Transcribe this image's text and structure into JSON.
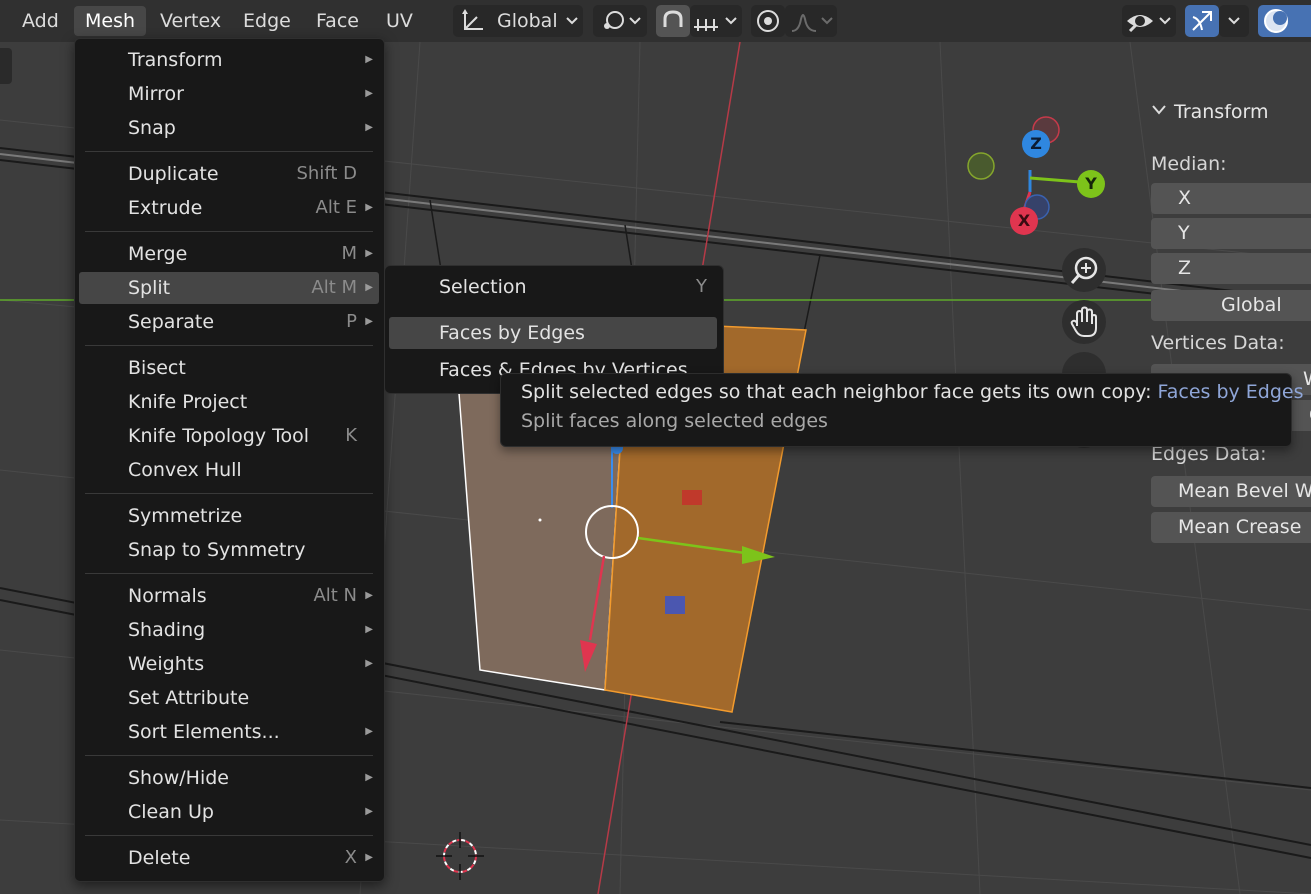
{
  "header": {
    "menus": [
      "Add",
      "Mesh",
      "Vertex",
      "Edge",
      "Face",
      "UV"
    ],
    "active_menu": "Mesh",
    "orientation": "Global"
  },
  "mesh_menu": {
    "items": [
      {
        "label": "Transform",
        "shortcut": "",
        "submenu": true
      },
      {
        "label": "Mirror",
        "shortcut": "",
        "submenu": true
      },
      {
        "label": "Snap",
        "shortcut": "",
        "submenu": true
      },
      {
        "label": "Duplicate",
        "shortcut": "Shift D",
        "submenu": false
      },
      {
        "label": "Extrude",
        "shortcut": "Alt E",
        "submenu": true
      },
      {
        "label": "Merge",
        "shortcut": "M",
        "submenu": true
      },
      {
        "label": "Split",
        "shortcut": "Alt M",
        "submenu": true
      },
      {
        "label": "Separate",
        "shortcut": "P",
        "submenu": true
      },
      {
        "label": "Bisect",
        "shortcut": "",
        "submenu": false
      },
      {
        "label": "Knife Project",
        "shortcut": "",
        "submenu": false
      },
      {
        "label": "Knife Topology Tool",
        "shortcut": "K",
        "submenu": false
      },
      {
        "label": "Convex Hull",
        "shortcut": "",
        "submenu": false
      },
      {
        "label": "Symmetrize",
        "shortcut": "",
        "submenu": false
      },
      {
        "label": "Snap to Symmetry",
        "shortcut": "",
        "submenu": false
      },
      {
        "label": "Normals",
        "shortcut": "Alt N",
        "submenu": true
      },
      {
        "label": "Shading",
        "shortcut": "",
        "submenu": true
      },
      {
        "label": "Weights",
        "shortcut": "",
        "submenu": true
      },
      {
        "label": "Set Attribute",
        "shortcut": "",
        "submenu": false
      },
      {
        "label": "Sort Elements...",
        "shortcut": "",
        "submenu": true
      },
      {
        "label": "Show/Hide",
        "shortcut": "",
        "submenu": true
      },
      {
        "label": "Clean Up",
        "shortcut": "",
        "submenu": true
      },
      {
        "label": "Delete",
        "shortcut": "X",
        "submenu": true
      }
    ],
    "highlighted": "Split"
  },
  "split_submenu": {
    "items": [
      {
        "label": "Selection",
        "shortcut": "Y"
      },
      {
        "label": "Faces by Edges",
        "shortcut": ""
      },
      {
        "label": "Faces & Edges by Vertices",
        "shortcut": ""
      }
    ],
    "highlighted": "Faces by Edges"
  },
  "tooltip": {
    "line1": "Split selected edges so that each neighbor face gets its own copy:",
    "operator": "Faces by Edges",
    "line2": "Split faces along selected edges"
  },
  "gizmo": {
    "x": "X",
    "y": "Y",
    "z": "Z"
  },
  "n_panel": {
    "title": "Transform",
    "median_label": "Median:",
    "fields": [
      "X",
      "Y",
      "Z"
    ],
    "space": "Global",
    "vertices_label": "Vertices Data:",
    "vertices_fields": [
      "We",
      "C"
    ],
    "edges_label": "Edges Data:",
    "edges_fields": [
      "Mean Bevel We",
      "Mean Crease"
    ]
  },
  "colors": {
    "accent": "#4772b3",
    "selected_face": "#e08a28",
    "axis_x": "#e0354f",
    "axis_y": "#7dc31a",
    "axis_z": "#2f87e0"
  },
  "icons": [
    "orientation-icon",
    "pivot-icon",
    "snap-icon",
    "snap-increment-icon",
    "proportional-edit-icon",
    "falloff-icon",
    "visibility-icon",
    "gizmo-toggle-icon",
    "shading-icon",
    "zoom-icon",
    "hand-icon",
    "cursor-icon"
  ]
}
